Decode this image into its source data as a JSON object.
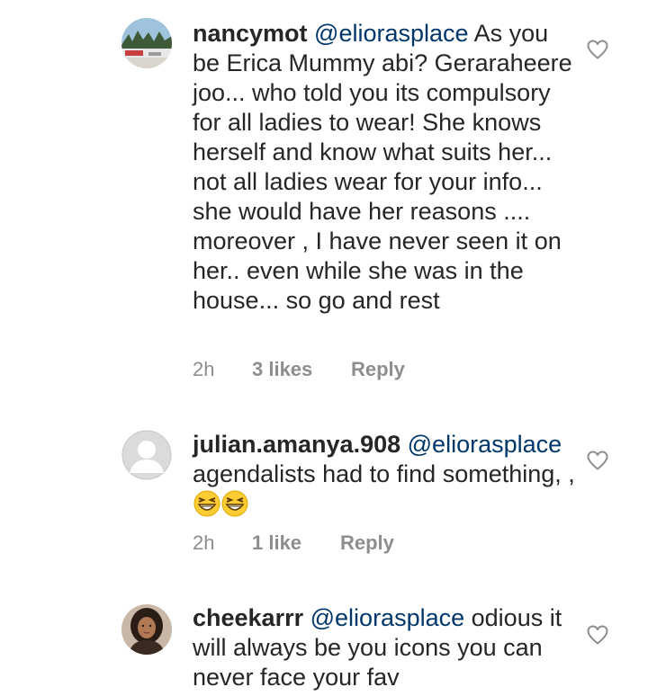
{
  "comments": [
    {
      "username": "nancymot",
      "mention": "@eliorasplace",
      "text": "As you be Erica Mummy abi? Geraraheere joo... who told you its compulsory for all ladies to wear! She knows herself and know what suits her... not all ladies wear for your info... she would have her reasons .... moreover , I have never seen it on her.. even while she was in the house... so go and rest",
      "time": "2h",
      "likes": "3 likes",
      "reply": "Reply",
      "avatar": "snowy-landscape-photo"
    },
    {
      "username": "julian.amanya.908",
      "mention": "@eliorasplace",
      "text": "agendalists had to find something, ,",
      "emoji": [
        "grinning-squinting-face",
        "grinning-squinting-face"
      ],
      "time": "2h",
      "likes": "1 like",
      "reply": "Reply",
      "avatar": "default-user-avatar"
    },
    {
      "username": "cheekarrr",
      "mention": "@eliorasplace",
      "text": "odious it will always be you icons you can never face your fav",
      "avatar": "woman-portrait-photo"
    }
  ],
  "colors": {
    "text": "#262626",
    "mention": "#00376b",
    "meta": "#8e8e8e",
    "heart": "#8e8e8e"
  },
  "icons": [
    "heart-icon",
    "emoji-icon"
  ]
}
